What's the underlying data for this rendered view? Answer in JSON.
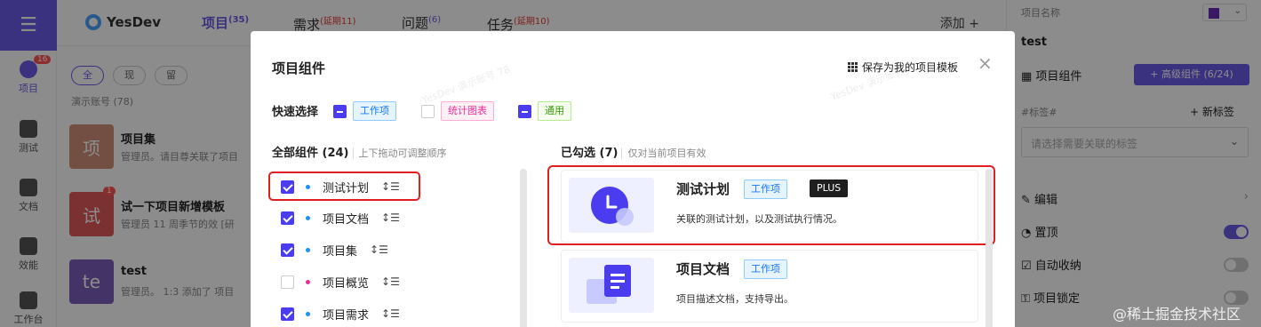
{
  "nav": {
    "items": [
      {
        "label": "项目",
        "badge": "16"
      },
      {
        "label": "测试"
      },
      {
        "label": "文档"
      },
      {
        "label": "效能"
      },
      {
        "label": "工作台"
      }
    ]
  },
  "topbar": {
    "logo": "YesDev",
    "tabs": [
      {
        "label": "项目",
        "count": "(35)"
      },
      {
        "label": "需求",
        "warn": "(延期11)"
      },
      {
        "label": "问题",
        "count": "(6)"
      },
      {
        "label": "任务",
        "warn": "(延期10)"
      }
    ],
    "add": "添加 +"
  },
  "list": {
    "filters": [
      "全",
      "现",
      "留"
    ],
    "demo_count": "演示账号 (78)",
    "projects": [
      {
        "avatar": "项",
        "name": "项目集",
        "desc": "管理员。请目尊关联了项目",
        "color": "#d08f7a"
      },
      {
        "avatar": "试",
        "name": "试一下项目新增模板",
        "desc": "管理员 11 周季节的效  [研",
        "color": "#e05a5a",
        "badge": "1"
      },
      {
        "avatar": "te",
        "name": "test",
        "desc": "管理员。 1:3 添加了 项目",
        "color": "#7d5dbb"
      }
    ]
  },
  "right_panel": {
    "name_label": "项目名称",
    "name_value": "test",
    "components_label": "项目组件",
    "advanced_button": "+ 高级组件 (6/24)",
    "tags_label": "#标签#",
    "new_tag": "+ 新标签",
    "tag_placeholder": "请选择需要关联的标签",
    "rows": [
      {
        "label": "编辑",
        "kind": "arrow"
      },
      {
        "label": "置顶",
        "kind": "toggle",
        "on": true
      },
      {
        "label": "自动收纳",
        "kind": "toggle",
        "on": false
      },
      {
        "label": "项目锁定",
        "kind": "toggle",
        "on": false
      }
    ]
  },
  "modal": {
    "title": "项目组件",
    "save_template": "保存为我的项目模板",
    "quick_select": {
      "label": "快速选择",
      "options": [
        {
          "label": "工作项",
          "state": "partial",
          "style": "blue"
        },
        {
          "label": "统计图表",
          "state": "unchecked",
          "style": "pink"
        },
        {
          "label": "通用",
          "state": "partial",
          "style": "green"
        }
      ]
    },
    "all_components": {
      "title": "全部组件 (24)",
      "hint": "上下拖动可调整顺序",
      "items": [
        {
          "label": "测试计划",
          "checked": true,
          "bullet": "#1890ff"
        },
        {
          "label": "项目文档",
          "checked": true,
          "bullet": "#1890ff"
        },
        {
          "label": "项目集",
          "checked": true,
          "bullet": "#1890ff"
        },
        {
          "label": "项目概览",
          "checked": false,
          "bullet": "#eb2f96"
        },
        {
          "label": "项目需求",
          "checked": true,
          "bullet": "#1890ff"
        }
      ]
    },
    "selected": {
      "title": "已勾选 (7)",
      "hint": "仅对当前项目有效",
      "cards": [
        {
          "title": "测试计划",
          "tag": "工作项",
          "plus": "PLUS",
          "desc": "关联的测试计划，以及测试执行情况。"
        },
        {
          "title": "项目文档",
          "tag": "工作项",
          "desc": "项目描述文档，支持导出。"
        }
      ]
    },
    "drag_glyph": "↕☰",
    "close_glyph": "×"
  },
  "watermark": "YesDev 演示账号 78",
  "footer_watermark": "@稀土掘金技术社区",
  "colors": {
    "accent": "#6c5ce7",
    "checkbox": "#4b3cf0",
    "highlight": "#e02020"
  }
}
